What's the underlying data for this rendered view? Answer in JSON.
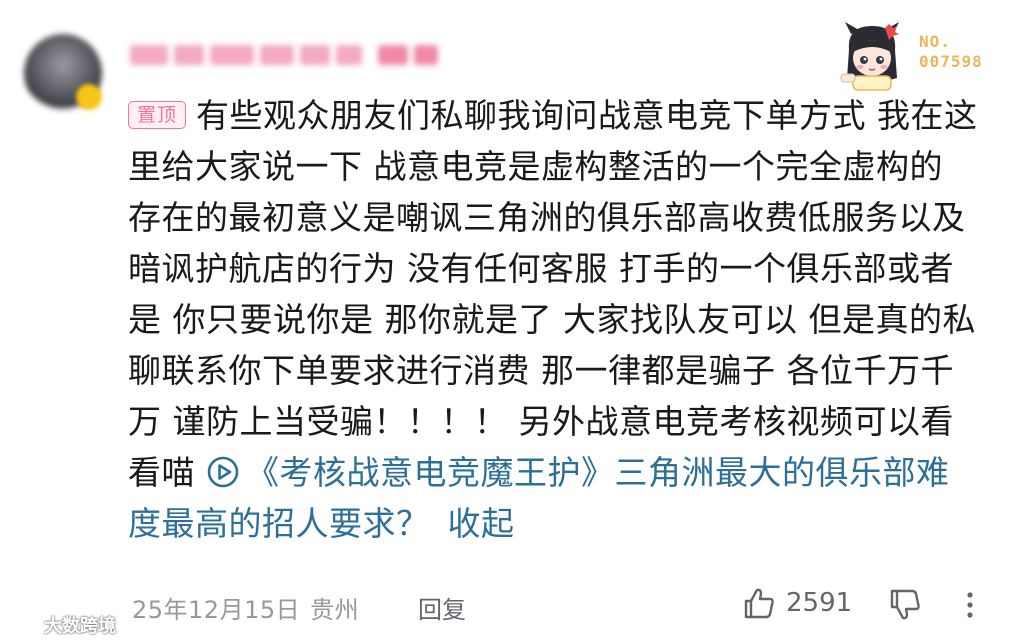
{
  "comment": {
    "pin_label": "置顶",
    "text": "有些观众朋友们私聊我询问战意电竞下单方式 我在这里给大家说一下 战意电竞是虚构整活的一个完全虚构的 存在的最初意义是嘲讽三角洲的俱乐部高收费低服务以及暗讽护航店的行为 没有任何客服 打手的一个俱乐部或者是 你只要说你是 那你就是了 大家找队友可以 但是真的私聊联系你下单要求进行消费 那一律都是骗子 各位千万千万 谨防上当受骗！！！！ 另外战意电竞考核视频可以看看喵",
    "video_link_text": "《考核战意电竞魔王护》三角洲最大的俱乐部难度最高的招人要求？",
    "collapse_label": "收起"
  },
  "fan_badge": {
    "number_prefix": "NO.",
    "number": "007598"
  },
  "footer": {
    "date": "25年12月15日",
    "location": "贵州",
    "reply_label": "回复",
    "like_count": "2591"
  },
  "watermark": {
    "text": "大数跨境"
  },
  "colors": {
    "link": "#2e6f9a",
    "pin": "#fb7299",
    "meta": "#9499a0"
  },
  "icons": [
    "play-circle-icon",
    "thumb-up-icon",
    "thumb-down-icon",
    "more-vertical-icon"
  ]
}
